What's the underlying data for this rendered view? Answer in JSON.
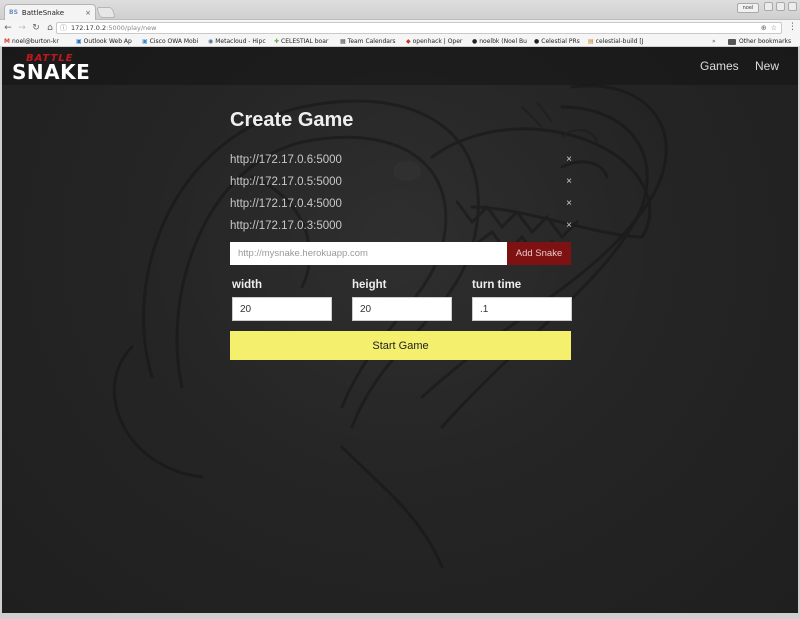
{
  "browser": {
    "tab": {
      "favicon_text": "BS",
      "title": "BattleSnake",
      "close": "×"
    },
    "profile_label": "noel",
    "address": {
      "host": "172.17.0.2",
      "path": ":5000/play/new"
    },
    "bookmarks": [
      {
        "icon": "M",
        "color": "#d44638",
        "label": "noel@burton-kr"
      },
      {
        "icon": "▣",
        "color": "#2a6ebb",
        "label": "Outlook Web Ap"
      },
      {
        "icon": "▣",
        "color": "#3b8cc4",
        "label": "Cisco OWA Mobi"
      },
      {
        "icon": "◉",
        "color": "#556b8d",
        "label": "Metacloud - Hipc"
      },
      {
        "icon": "✚",
        "color": "#6aa84f",
        "label": "CELESTIAL boar"
      },
      {
        "icon": "▦",
        "color": "#555555",
        "label": "Team Calendars"
      },
      {
        "icon": "◆",
        "color": "#c0392b",
        "label": "openhack | Oper"
      },
      {
        "icon": "●",
        "color": "#222222",
        "label": "noelbk (Noel Bu"
      },
      {
        "icon": "●",
        "color": "#222222",
        "label": "Celestial PRs"
      },
      {
        "icon": "▤",
        "color": "#c27c2c",
        "label": "celestial-build [J"
      }
    ],
    "bookmarks_overflow": "»",
    "other_bookmarks": "Other bookmarks"
  },
  "site": {
    "logo_top": "BATTLE",
    "logo_main": "SNAKE",
    "nav": {
      "games": "Games",
      "new": "New"
    }
  },
  "form": {
    "title": "Create Game",
    "snakes": [
      {
        "url": "http://172.17.0.6:5000",
        "remove": "×"
      },
      {
        "url": "http://172.17.0.5:5000",
        "remove": "×"
      },
      {
        "url": "http://172.17.0.4:5000",
        "remove": "×"
      },
      {
        "url": "http://172.17.0.3:5000",
        "remove": "×"
      }
    ],
    "add_snake": {
      "placeholder": "http://mysnake.herokuapp.com",
      "value": "",
      "button": "Add Snake"
    },
    "width": {
      "label": "width",
      "value": "20"
    },
    "height": {
      "label": "height",
      "value": "20"
    },
    "turn_time": {
      "label": "turn time",
      "value": ".1"
    },
    "start_button": "Start Game"
  }
}
